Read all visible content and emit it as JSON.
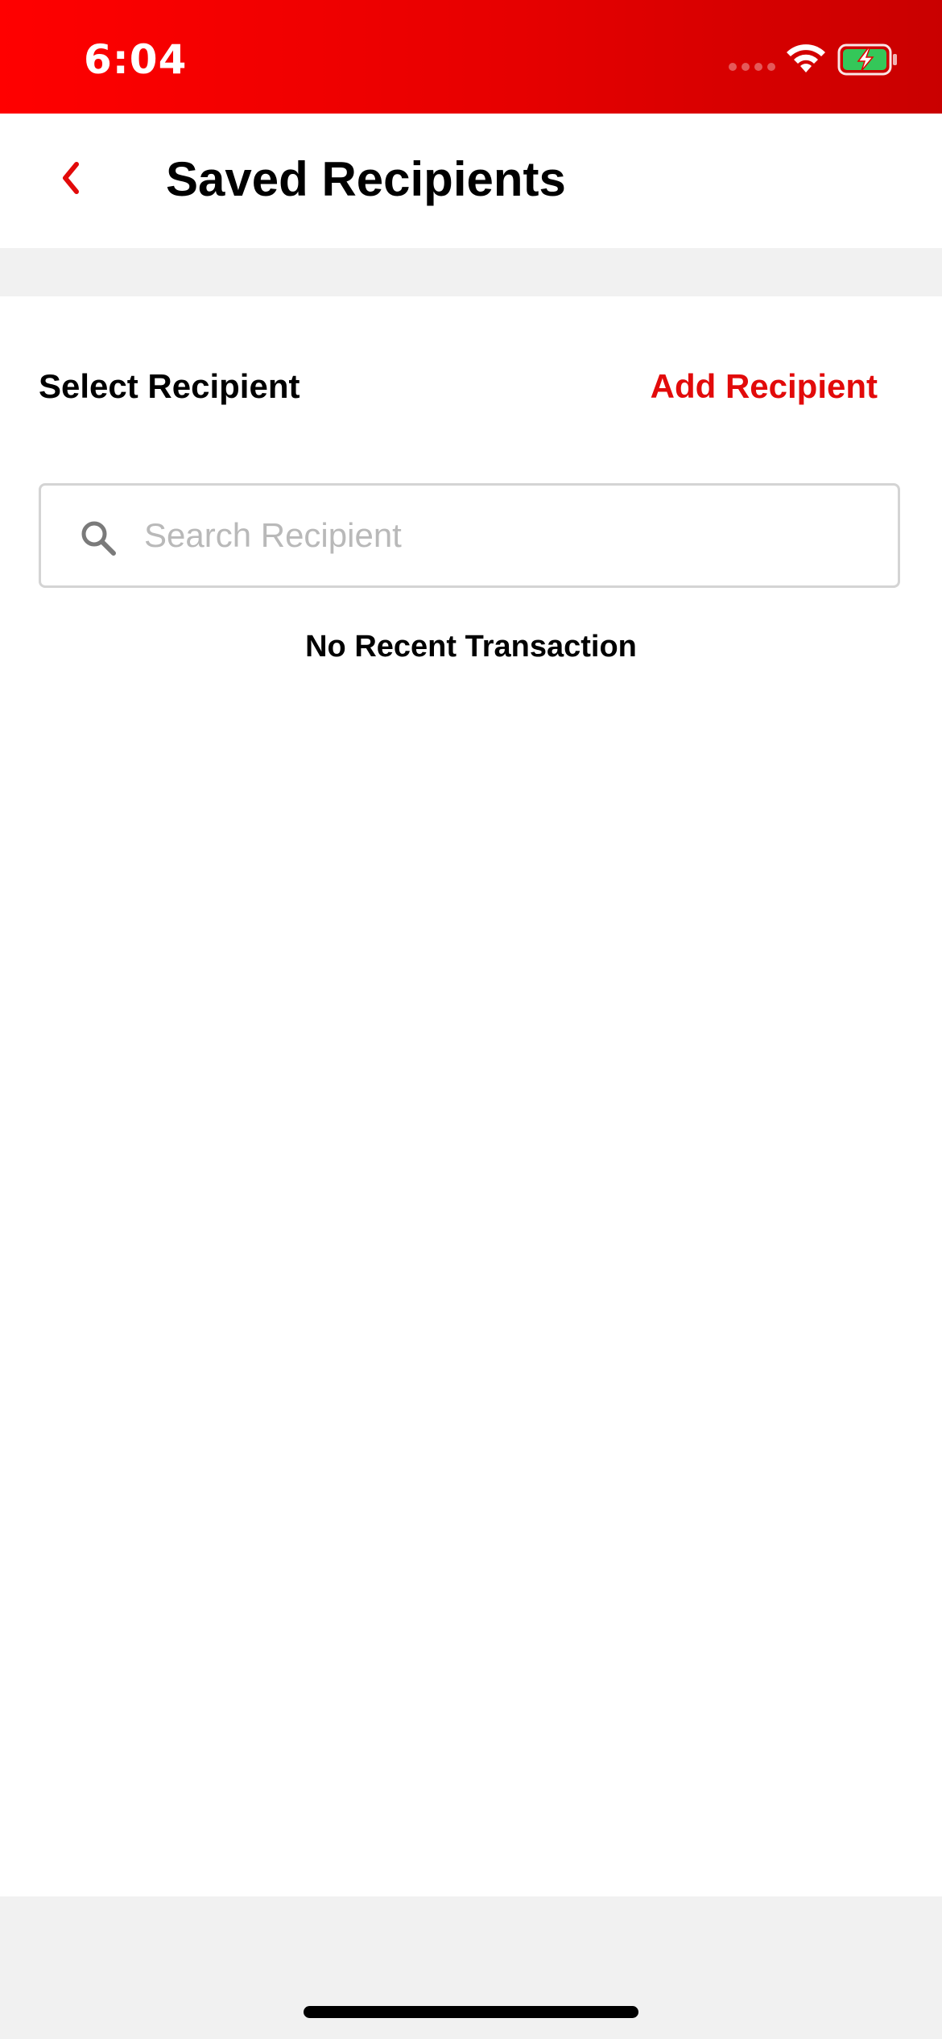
{
  "status_bar": {
    "time": "6:04",
    "icons": [
      "signal-icon",
      "wifi-icon",
      "battery-charging-icon"
    ],
    "background_color": "#ff0000",
    "battery_color": "#34c759"
  },
  "header": {
    "back_icon": "chevron-left-icon",
    "title": "Saved Recipients"
  },
  "content": {
    "section_label": "Select Recipient",
    "add_recipient_label": "Add Recipient",
    "search": {
      "icon": "search-icon",
      "placeholder": "Search Recipient",
      "value": ""
    },
    "empty_message": "No Recent Transaction"
  },
  "colors": {
    "accent": "#e20a0a",
    "band": "#f1f1f1",
    "text": "#000000",
    "placeholder": "#b9b9b9"
  }
}
